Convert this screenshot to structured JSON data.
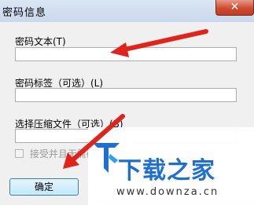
{
  "window": {
    "title": "密码信息",
    "close_label": "✕"
  },
  "fields": [
    {
      "label": "密码文本(T)",
      "value": ""
    },
    {
      "label": "密码标签（可选）(L)",
      "value": ""
    },
    {
      "label": "选择压缩文件（可选）(B)",
      "value": ""
    }
  ],
  "checkbox": {
    "label": "接受并且无需确认",
    "checked": false
  },
  "buttons": {
    "ok_label": "确定"
  },
  "watermark": {
    "brand": "下载之家",
    "url": "www.downza.cn"
  },
  "colors": {
    "annotation_arrow": "#e0231b",
    "brand_blue": "#1e6fd0",
    "close_red": "#cf4a31"
  }
}
